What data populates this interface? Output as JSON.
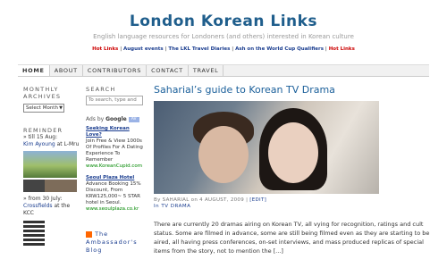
{
  "site": {
    "title": "London Korean Links",
    "tagline": "English language resources for Londoners (and others) interested in Korean culture"
  },
  "featured_links": {
    "hot_links": "Hot Links",
    "august_events": "August events",
    "lkl_travel": "The LKL Travel Diaries",
    "ash_world_cup": "Ash on the World Cup Qualifiers",
    "hot_links_2": "Hot Links",
    "separator": "|"
  },
  "nav": {
    "tabs": [
      "HOME",
      "ABOUT",
      "CONTRIBUTORS",
      "CONTACT",
      "TRAVEL"
    ],
    "active": "HOME"
  },
  "sidebar_left": {
    "archives_title": "Monthly Archives",
    "archives_select": "Select Month",
    "reminder_title": "Reminder",
    "reminder1_prefix": "» till 15 Aug:",
    "reminder1_link": "Kim Ayoung",
    "reminder1_suffix": "at L-Mru",
    "reminder2_prefix": "» from 30 July:",
    "reminder2_link": "Crossfields",
    "reminder2_suffix": "at the KCC"
  },
  "sidebar_right": {
    "search_title": "Search",
    "search_placeholder": "To search, type and",
    "ads_prefix": "Ads by",
    "ads_brand": "Google",
    "ads_icon": "AV",
    "ads": [
      {
        "title": "Seeking Korean Love?",
        "body": "Join Free & View 1000s Of Profiles For A Dating Experience To Remember",
        "url": "www.KoreanCupid.com"
      },
      {
        "title": "Seoul Plaza Hotel",
        "body": "Advance Booking 15% Discount, From KRW125,000~ 5 STAR hotel in Seoul.",
        "url": "www.seoulplaza.co.kr"
      }
    ],
    "rss_label": "The Ambassador's Blog"
  },
  "post": {
    "title": "Saharial’s guide to Korean TV Drama",
    "meta_by": "By SAHARIAL on 4 AUGUST, 2009 |",
    "meta_edit": "[EDIT]",
    "meta_category_prefix": "In",
    "meta_category": "TV DRAMA",
    "excerpt": "There are currently 20 dramas airing on Korean TV, all vying for recognition, ratings and cult status. Some are filmed in advance, some are still being filmed even as they are starting to be aired, all having press conferences, on-set interviews, and mass produced replicas of special items from the story, not to mention the [...]"
  },
  "colors": {
    "title_blue": "#1f5e8c",
    "link_blue": "#1a3d8f",
    "hot_red": "#cc0000"
  }
}
